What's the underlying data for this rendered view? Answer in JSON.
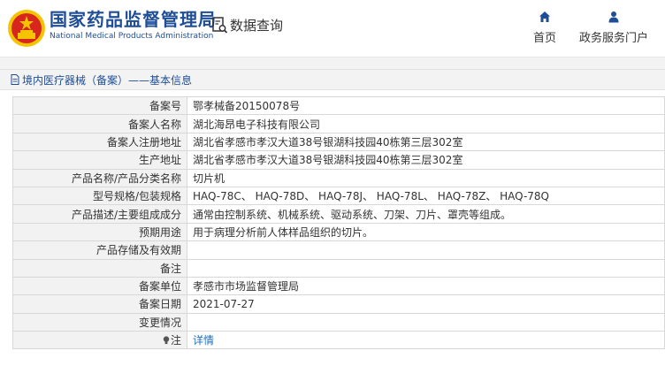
{
  "header": {
    "brand_cn": "国家药品监督管理局",
    "brand_en": "National Medical Products Administration",
    "data_query": "数据查询",
    "nav": [
      {
        "label": "首页",
        "icon": "home-icon"
      },
      {
        "label": "政务服务门户",
        "icon": "person-icon"
      }
    ]
  },
  "section": {
    "title": "境内医疗器械（备案）——基本信息"
  },
  "rows": [
    {
      "label": "备案号",
      "value": "鄂孝械备20150078号"
    },
    {
      "label": "备案人名称",
      "value": "湖北海昂电子科技有限公司"
    },
    {
      "label": "备案人注册地址",
      "value": "湖北省孝感市孝汉大道38号银湖科技园40栋第三层302室"
    },
    {
      "label": "生产地址",
      "value": "湖北省孝感市孝汉大道38号银湖科技园40栋第三层302室"
    },
    {
      "label": "产品名称/产品分类名称",
      "value": "切片机"
    },
    {
      "label": "型号规格/包装规格",
      "value": "HAQ-78C、 HAQ-78D、 HAQ-78J、 HAQ-78L、 HAQ-78Z、 HAQ-78Q"
    },
    {
      "label": "产品描述/主要组成成分",
      "value": "通常由控制系统、机械系统、驱动系统、刀架、刀片、罩壳等组成。"
    },
    {
      "label": "预期用途",
      "value": "用于病理分析前人体样品组织的切片。"
    },
    {
      "label": "产品存储及有效期",
      "value": ""
    },
    {
      "label": "备注",
      "value": ""
    },
    {
      "label": "备案单位",
      "value": "孝感市市场监督管理局"
    },
    {
      "label": "备案日期",
      "value": "2021-07-27"
    },
    {
      "label": "变更情况",
      "value": ""
    }
  ],
  "note_row": {
    "label": "注",
    "link": "详情"
  },
  "colors": {
    "brand": "#1f4e96",
    "link": "#1f6fbf",
    "label_bg": "#f2f2f2"
  }
}
